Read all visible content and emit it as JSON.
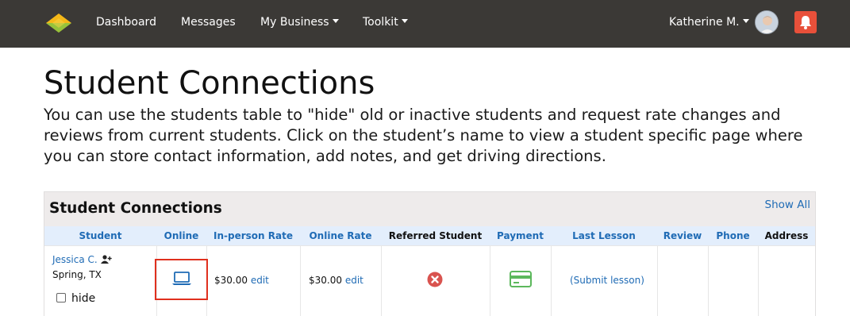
{
  "nav": {
    "items": [
      {
        "label": "Dashboard",
        "dropdown": false
      },
      {
        "label": "Messages",
        "dropdown": false
      },
      {
        "label": "My Business",
        "dropdown": true
      },
      {
        "label": "Toolkit",
        "dropdown": true
      }
    ],
    "user_name": "Katherine M.",
    "colors": {
      "bar": "#3b3936",
      "bell": "#e8503a",
      "logo_top": "#f5b818",
      "logo_bottom": "#8cc43f"
    }
  },
  "page": {
    "title": "Student Connections",
    "intro_lines": [
      "You can use the students table to \"hide\" old or inactive students and request rate changes and",
      "reviews from current students. Click on the student’s name to view a student specific page where",
      "you can store contact information, add notes, and get driving directions."
    ]
  },
  "panel": {
    "title": "Student Connections",
    "show_all": "Show All",
    "columns": [
      "Student",
      "Online",
      "In-person Rate",
      "Online Rate",
      "Referred Student",
      "Payment",
      "Last Lesson",
      "Review",
      "Phone",
      "Address"
    ],
    "rows": [
      {
        "student_name": "Jessica C.",
        "location": "Spring, TX",
        "hide_label": "hide",
        "hidden": false,
        "online_icon": "laptop-icon",
        "inperson_rate": "$30.00",
        "online_rate": "$30.00",
        "edit_label": "edit",
        "referred_icon": "x-circle-icon",
        "payment_icon": "credit-card-icon",
        "last_lesson": "(Submit lesson)",
        "review": "",
        "phone": "",
        "address": ""
      }
    ],
    "colors": {
      "link": "#1f6bb5",
      "header_bg": "#eeebeb",
      "col_header_bg": "#e3eefc",
      "referred_no": "#d9534f",
      "payment": "#5cb85c",
      "highlight": "#e0301e"
    }
  }
}
